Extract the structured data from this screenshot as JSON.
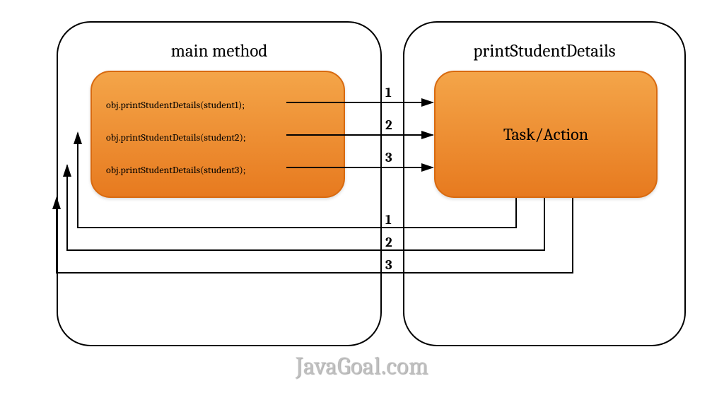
{
  "left": {
    "title": "main method",
    "lines": [
      "obj.printStudentDetails(student1);",
      "obj.printStudentDetails(student2);",
      "obj.printStudentDetails(student3);"
    ]
  },
  "right": {
    "title": "printStudentDetails",
    "task_label": "Task/Action"
  },
  "forward_labels": [
    "1",
    "2",
    "3"
  ],
  "return_labels": [
    "1",
    "2",
    "3"
  ],
  "watermark": "JavaGoal.com"
}
